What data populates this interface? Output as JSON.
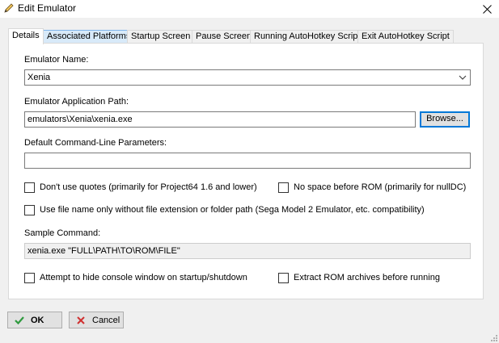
{
  "window": {
    "title": "Edit Emulator"
  },
  "tabs": [
    {
      "label": "Details"
    },
    {
      "label": "Associated Platforms"
    },
    {
      "label": "Startup Screen"
    },
    {
      "label": "Pause Screen"
    },
    {
      "label": "Running AutoHotkey Script"
    },
    {
      "label": "Exit AutoHotkey Script"
    }
  ],
  "form": {
    "emulator_name_label": "Emulator Name:",
    "emulator_name_value": "Xenia",
    "app_path_label": "Emulator Application Path:",
    "app_path_value": "emulators\\Xenia\\xenia.exe",
    "browse_label": "Browse...",
    "cmdline_label": "Default Command-Line Parameters:",
    "cmdline_value": "",
    "dont_use_quotes_label": "Don't use quotes (primarily for Project64 1.6 and lower)",
    "no_space_label": "No space before ROM (primarily for nullDC)",
    "file_name_only_label": "Use file name only without file extension or folder path (Sega Model 2 Emulator, etc. compatibility)",
    "sample_command_label": "Sample Command:",
    "sample_command_value": "xenia.exe \"FULL\\PATH\\TO\\ROM\\FILE\"",
    "hide_console_label": "Attempt to hide console window on startup/shutdown",
    "extract_rom_label": "Extract ROM archives before running"
  },
  "checkboxes": {
    "dont_use_quotes": false,
    "no_space": false,
    "file_name_only": false,
    "hide_console": false,
    "extract_rom": false
  },
  "footer": {
    "ok_label": "OK",
    "cancel_label": "Cancel"
  },
  "colors": {
    "ok_check": "#2e9a3e",
    "cancel_x": "#d03030",
    "focus_border": "#0078d7",
    "tab_hover": "#d8eaf9"
  }
}
